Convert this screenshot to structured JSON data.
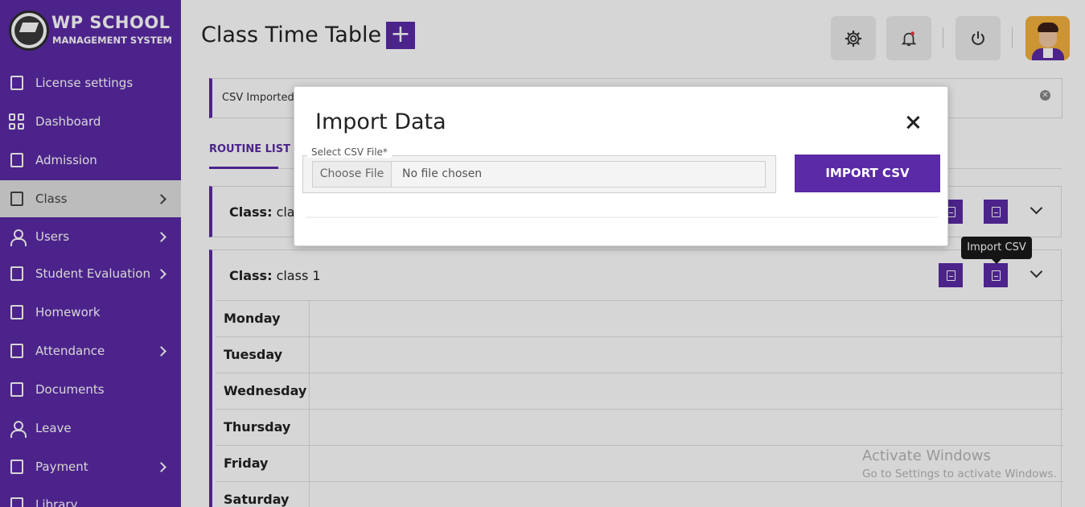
{
  "app": {
    "logo_title": "WP SCHOOL",
    "logo_subtitle": "MANAGEMENT SYSTEM"
  },
  "sidebar": {
    "items": [
      {
        "label": "License settings",
        "icon": "license-icon",
        "has_submenu": false,
        "active": false
      },
      {
        "label": "Dashboard",
        "icon": "dashboard-icon",
        "has_submenu": false,
        "active": false
      },
      {
        "label": "Admission",
        "icon": "admission-icon",
        "has_submenu": false,
        "active": false
      },
      {
        "label": "Class",
        "icon": "class-icon",
        "has_submenu": true,
        "active": true
      },
      {
        "label": "Users",
        "icon": "users-icon",
        "has_submenu": true,
        "active": false
      },
      {
        "label": "Student Evaluation",
        "icon": "evaluation-icon",
        "has_submenu": true,
        "active": false
      },
      {
        "label": "Homework",
        "icon": "homework-icon",
        "has_submenu": false,
        "active": false
      },
      {
        "label": "Attendance",
        "icon": "attendance-icon",
        "has_submenu": true,
        "active": false
      },
      {
        "label": "Documents",
        "icon": "documents-icon",
        "has_submenu": false,
        "active": false
      },
      {
        "label": "Leave",
        "icon": "leave-icon",
        "has_submenu": false,
        "active": false
      },
      {
        "label": "Payment",
        "icon": "payment-icon",
        "has_submenu": true,
        "active": false
      },
      {
        "label": "Library",
        "icon": "library-icon",
        "has_submenu": false,
        "active": false
      }
    ]
  },
  "header": {
    "title": "Class Time Table",
    "add_label": "+"
  },
  "alert": {
    "text": "CSV Imported"
  },
  "tabs": {
    "routine_list": "ROUTINE LIST"
  },
  "panels": [
    {
      "label": "Class:",
      "value": "class"
    },
    {
      "label": "Class:",
      "value": "class 1"
    }
  ],
  "days": [
    "Monday",
    "Tuesday",
    "Wednesday",
    "Thursday",
    "Friday",
    "Saturday"
  ],
  "tooltip": {
    "text": "Import CSV"
  },
  "watermark": {
    "line1": "Activate Windows",
    "line2": "Go to Settings to activate Windows."
  },
  "modal": {
    "title": "Import Data",
    "field_label": "Select CSV File*",
    "choose_file": "Choose File",
    "file_status": "No file chosen",
    "import_button": "IMPORT CSV"
  },
  "colors": {
    "brand": "#5b2aa6",
    "sidebar_active": "#e0e0e0"
  }
}
